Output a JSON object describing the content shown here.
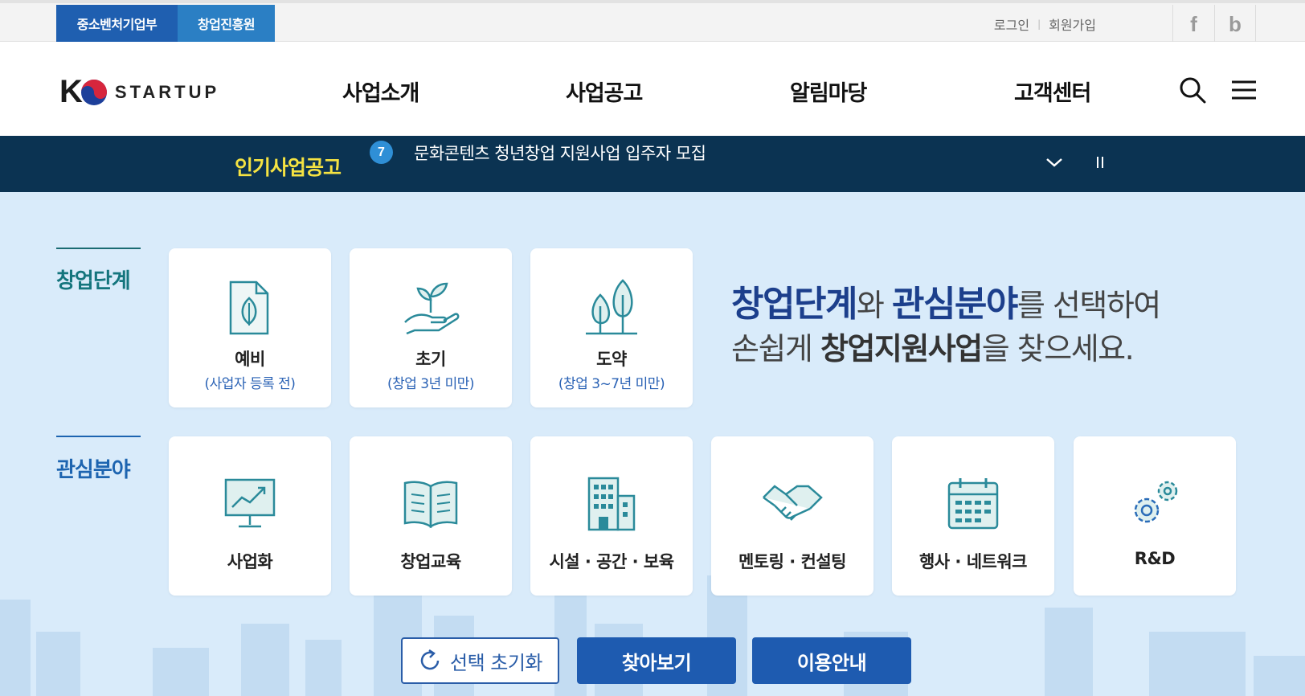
{
  "topbar": {
    "org_tabs": [
      "중소벤처기업부",
      "창업진흥원"
    ],
    "login": "로그인",
    "signup": "회원가입",
    "social": [
      {
        "icon": "facebook-icon",
        "glyph": "f"
      },
      {
        "icon": "blog-icon",
        "glyph": "b"
      }
    ]
  },
  "header": {
    "logo_k": "K",
    "logo_word": "STARTUP",
    "nav": [
      "사업소개",
      "사업공고",
      "알림마당",
      "고객센터"
    ]
  },
  "ticker": {
    "label": "인기사업공고",
    "number": "7",
    "text": "문화콘텐츠 청년창업 지원사업 입주자 모집"
  },
  "stage_section": {
    "label": "창업단계",
    "cards": [
      {
        "title": "예비",
        "sub": "(사업자 등록 전)",
        "icon": "document-leaf-icon"
      },
      {
        "title": "초기",
        "sub": "(창업 3년 미만)",
        "icon": "sprout-hand-icon"
      },
      {
        "title": "도약",
        "sub": "(창업 3~7년 미만)",
        "icon": "trees-icon"
      }
    ]
  },
  "headline": {
    "p1": "창업단계",
    "p2": "와 ",
    "p3": "관심분야",
    "p4": "를 선택하여",
    "p5": "손쉽게 ",
    "p6": "창업지원사업",
    "p7": "을 찾으세요."
  },
  "field_section": {
    "label": "관심분야",
    "cards": [
      {
        "title": "사업화",
        "icon": "chart-monitor-icon"
      },
      {
        "title": "창업교육",
        "icon": "open-book-icon"
      },
      {
        "title": "시설 · 공간 · 보육",
        "icon": "building-icon"
      },
      {
        "title": "멘토링 · 컨설팅",
        "icon": "handshake-icon"
      },
      {
        "title": "행사 · 네트워크",
        "icon": "calendar-icon"
      },
      {
        "title": "R&D",
        "icon": "gears-icon"
      }
    ]
  },
  "buttons": {
    "reset": "선택 초기화",
    "search": "찾아보기",
    "guide": "이용안내"
  },
  "colors": {
    "primary_blue": "#1e5bb0",
    "ticker_bg": "#0b3352",
    "ticker_label": "#f5e342",
    "main_bg": "#d9ebfa",
    "teal": "#14757d"
  }
}
